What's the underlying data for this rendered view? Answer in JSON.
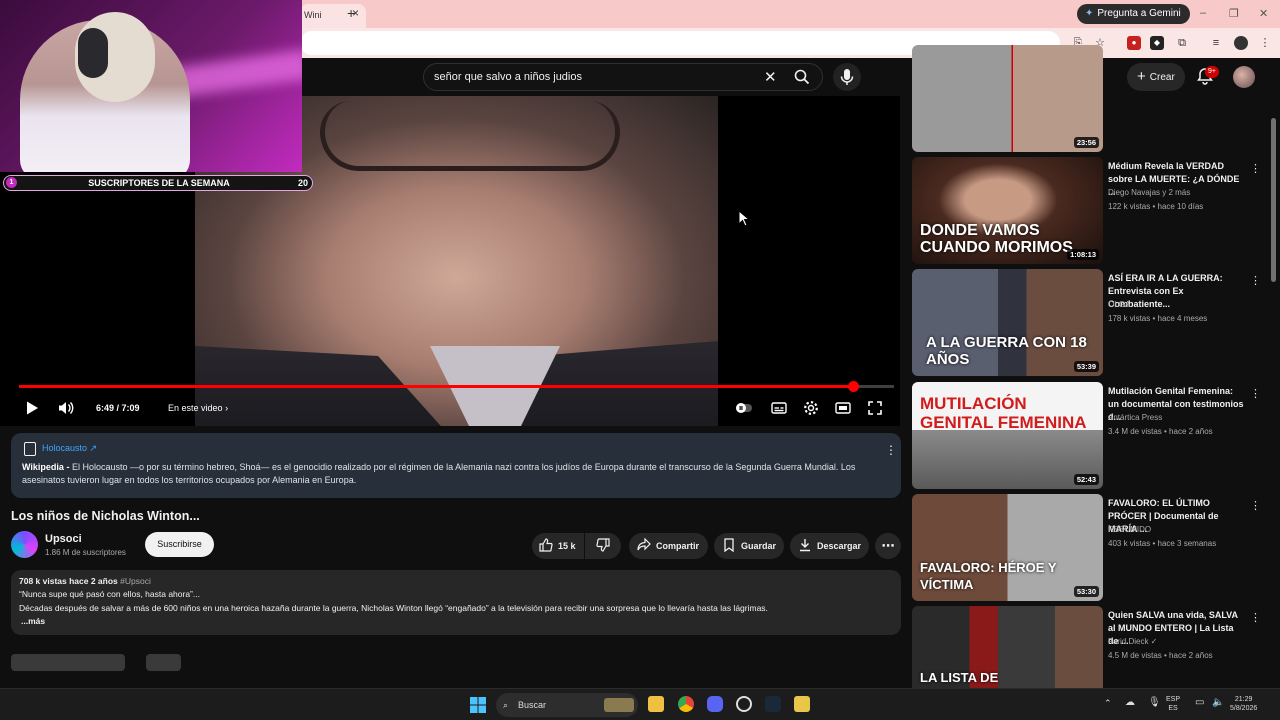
{
  "browser": {
    "tab_label": "Wini",
    "gemini_label": "Pregunta a Gemini",
    "win_min": "–",
    "win_max": "❐",
    "win_close": "✕"
  },
  "header": {
    "search_value": "señor que salvo a niños judios",
    "create_label": "Crear",
    "notif_count": "9+"
  },
  "webcam": {
    "sub_left": "1",
    "sub_title": "SUSCRIPTORES DE LA SEMANA",
    "sub_right": "20"
  },
  "player": {
    "time": "6:49 / 7:09",
    "chapter": "En este video",
    "progress_fraction": 0.953
  },
  "info_panel": {
    "link": "Holocausto",
    "source": "Wikipedia",
    "text": "El Holocausto —o por su término hebreo, Shoá— es el genocidio realizado por el régimen de la Alemania nazi contra los judíos de Europa durante el transcurso de la Segunda Guerra Mundial. Los asesinatos tuvieron lugar en todos los territorios ocupados por Alemania en Europa."
  },
  "video": {
    "title": "Los niños de Nicholas Winton...",
    "channel": "Upsoci",
    "subscribers": "1.86 M de suscriptores",
    "subscribe_label": "Suscribirse",
    "likes": "15 k",
    "share_label": "Compartir",
    "save_label": "Guardar",
    "download_label": "Descargar"
  },
  "description": {
    "meta": "708 k vistas  hace 2 años",
    "tag": "#Upsoci",
    "line1": "“Nunca supe qué pasó con ellos, hasta ahora”...",
    "line2": "Décadas después de salvar a más de 600 niños en una heroica hazaña durante la guerra, Nicholas Winton llegó “engañado” a la televisión para recibir una sorpresa que lo llevaría hasta las lágrimas.",
    "more": "...más"
  },
  "recommendations": [
    {
      "title": "",
      "channel": "",
      "meta": "",
      "duration": "23:56",
      "caption": ""
    },
    {
      "title": "Médium Revela la VERDAD sobre LA MUERTE: ¿A DÓNDE ...",
      "channel": "Diego Navajas y 2 más",
      "meta": "122 k vistas • hace 10 días",
      "duration": "1:08:13",
      "caption": "DONDE VAMOS CUANDO MORIMOS"
    },
    {
      "title": "ASÍ ERA IR A LA GUERRA: Entrevista con Ex Combatiente...",
      "channel": "OLGA",
      "meta": "178 k vistas • hace 4 meses",
      "duration": "53:39",
      "caption": "A LA GUERRA CON 18 AÑOS"
    },
    {
      "title": "Mutilación Genital Femenina: un documental con testimonios d...",
      "channel": "Antártica Press",
      "meta": "3.4 M de vistas • hace 2 años",
      "duration": "52:43",
      "caption": "MUTILACIÓN GENITAL FEMENINA"
    },
    {
      "title": "FAVALORO: EL ÚLTIMO PRÓCER | Documental de MARÍA ...",
      "channel": "RESUMIDO",
      "meta": "403 k vistas • hace 3 semanas",
      "duration": "53:30",
      "caption": "FAVALORO: HÉROE Y VÍCTIMA"
    },
    {
      "title": "Quien SALVA una vida, SALVA al MUNDO ENTERO | La Lista de ...",
      "channel": "Farid Dieck ✓",
      "meta": "4.5 M de vistas • hace 2 años",
      "duration": "",
      "caption": "LA LISTA DE"
    }
  ],
  "taskbar": {
    "search_label": "Buscar",
    "lang_top": "ESP",
    "lang_bottom": "ES",
    "time": "21:29",
    "date": "5/8/2026"
  },
  "colors": {
    "accent_red": "#ff0000",
    "link_blue": "#3ea6ff",
    "webcam_purple": "#c22bbf"
  }
}
